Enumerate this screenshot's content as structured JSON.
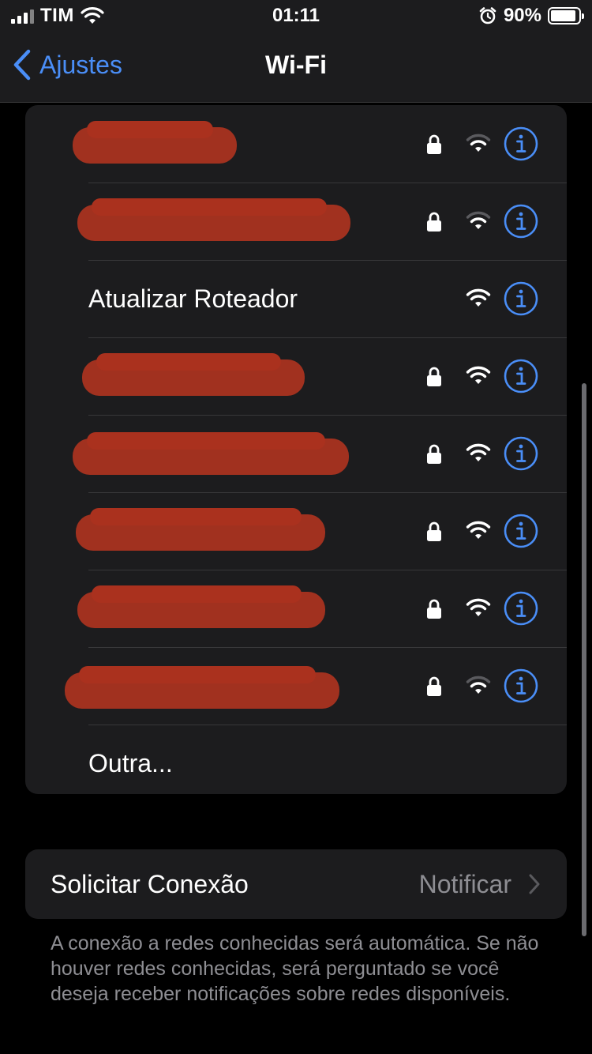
{
  "status_bar": {
    "carrier": "TIM",
    "time": "01:11",
    "battery_percent": "90%",
    "battery_level": 0.9,
    "icons": [
      "signal-icon",
      "wifi-icon",
      "alarm-icon",
      "battery-icon"
    ]
  },
  "nav": {
    "back_label": "Ajustes",
    "title": "Wi-Fi"
  },
  "networks": [
    {
      "name": "",
      "redacted": true,
      "locked": true,
      "signal": 2
    },
    {
      "name": "",
      "redacted": true,
      "locked": true,
      "signal": 2
    },
    {
      "name": "Atualizar Roteador",
      "redacted": false,
      "locked": false,
      "signal": 3
    },
    {
      "name": "",
      "redacted": true,
      "locked": true,
      "signal": 3
    },
    {
      "name": "",
      "redacted": true,
      "locked": true,
      "signal": 3
    },
    {
      "name": "",
      "redacted": true,
      "locked": true,
      "signal": 3
    },
    {
      "name": "",
      "redacted": true,
      "locked": true,
      "signal": 3
    },
    {
      "name": "",
      "redacted": true,
      "locked": true,
      "signal": 2
    }
  ],
  "other_label": "Outra...",
  "ask_to_join": {
    "label": "Solicitar Conexão",
    "value": "Notificar"
  },
  "footnote": "A conexão a redes conhecidas será automática. Se não houver redes conhecidas, será perguntado se você deseja receber notificações sobre redes disponíveis.",
  "colors": {
    "accent": "#4a8ef7",
    "background": "#000000",
    "cell": "#1c1c1e",
    "secondary_text": "#8e8e93",
    "redaction": "#a93320"
  }
}
